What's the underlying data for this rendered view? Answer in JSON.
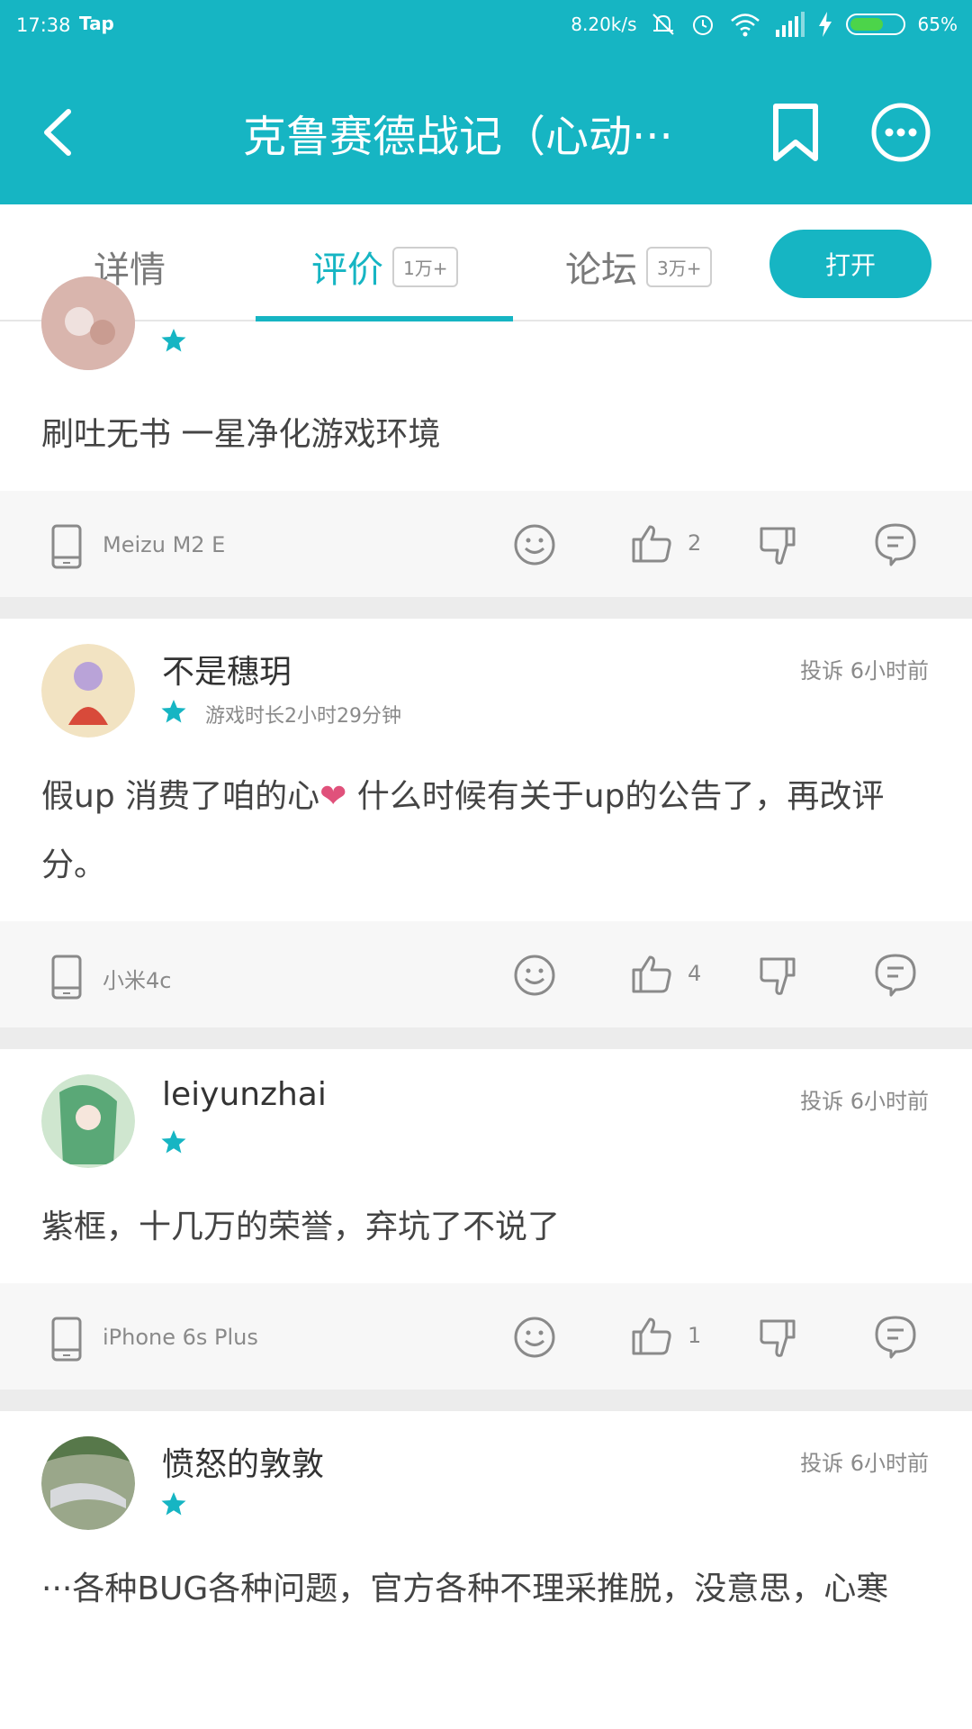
{
  "status_bar": {
    "time": "17:38",
    "app": "Tap",
    "speed": "8.20k/s",
    "battery_percent": "65%",
    "battery_level": 0.65
  },
  "app_bar": {
    "title": "克鲁赛德战记（心动···"
  },
  "tabs": [
    {
      "label": "详情",
      "count": ""
    },
    {
      "label": "评价",
      "count": "1万+"
    },
    {
      "label": "论坛",
      "count": "3万+"
    }
  ],
  "open_button": "打开",
  "reviews": [
    {
      "username": "",
      "meta": "",
      "report_label": "",
      "time": "",
      "text": "刷吐无书 一星净化游戏环境",
      "device": "Meizu M2 E",
      "likes": "2",
      "stars": 1
    },
    {
      "username": "不是穗玥",
      "meta": "游戏时长2小时29分钟",
      "report_label": "投诉",
      "time": "6小时前",
      "text_before_heart": "假up 消费了咱的心",
      "text_after_heart": " 什么时候有关于up的公告了，再改评分。",
      "device": "小米4c",
      "likes": "4",
      "stars": 1
    },
    {
      "username": "leiyunzhai",
      "meta": "",
      "report_label": "投诉",
      "time": "6小时前",
      "text": "紫框，十几万的荣誉，弃坑了不说了",
      "device": "iPhone 6s Plus",
      "likes": "1",
      "stars": 1
    },
    {
      "username": "愤怒的敦敦",
      "meta": "",
      "report_label": "投诉",
      "time": "6小时前",
      "text": "···各种BUG各种问题，官方各种不理采推脱，没意思，心寒",
      "stars": 1
    }
  ],
  "icons": {
    "back": "back-arrow-icon",
    "bookmark": "bookmark-icon",
    "more": "more-icon",
    "star": "star-icon",
    "device": "phone-icon",
    "emoji": "emoji-icon",
    "like": "thumbs-up-icon",
    "dislike": "thumbs-down-icon",
    "comment": "comment-icon"
  },
  "colors": {
    "accent": "#16b5c3",
    "star": "#16b5c3",
    "heart": "#e0517b",
    "battery": "#4cd44a"
  }
}
